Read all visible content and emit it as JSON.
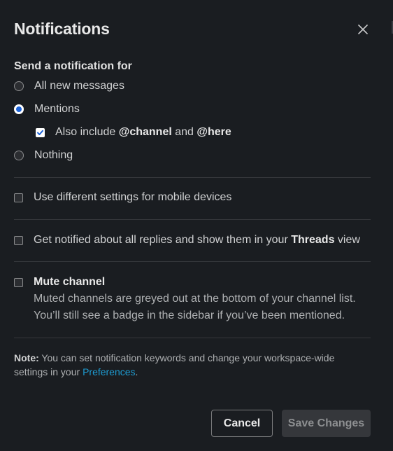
{
  "modal": {
    "title": "Notifications",
    "close_icon": "close-icon"
  },
  "send_for": {
    "label": "Send a notification for",
    "options": [
      {
        "label": "All new messages",
        "checked": false
      },
      {
        "label": "Mentions",
        "checked": true
      },
      {
        "label": "Nothing",
        "checked": false
      }
    ],
    "also_include": {
      "checked": true,
      "prefix": "Also include ",
      "channel": "@channel",
      "and": " and ",
      "here": "@here"
    }
  },
  "mobile": {
    "label": "Use different settings for mobile devices",
    "checked": false
  },
  "threads": {
    "prefix": "Get notified about all replies and show them in your ",
    "bold": "Threads",
    "suffix": " view",
    "checked": false
  },
  "mute": {
    "label": "Mute channel",
    "checked": false,
    "desc_line1": "Muted channels are greyed out at the bottom of your channel list.",
    "desc_line2": "You’ll still see a badge in the sidebar if you’ve been mentioned."
  },
  "note": {
    "lead": "Note:",
    "text": " You can set notification keywords and change your workspace-wide settings in your ",
    "link": "Preferences",
    "end": "."
  },
  "footer": {
    "cancel_label": "Cancel",
    "save_label": "Save Changes"
  },
  "colors": {
    "background": "#1a1d21",
    "link": "#1d9bd1",
    "radio_selected": "#1d64d9"
  }
}
